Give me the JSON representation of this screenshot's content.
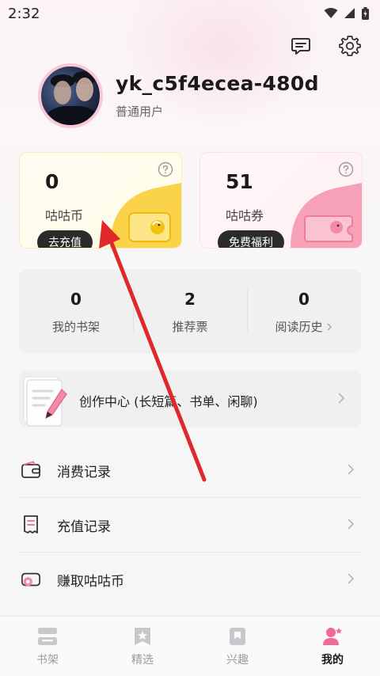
{
  "status_bar": {
    "time": "2:32"
  },
  "profile": {
    "username": "yk_c5f4ecea-480d",
    "level": "普通用户"
  },
  "wallet": {
    "coins": {
      "value": "0",
      "label": "咕咕币",
      "button": "去充值"
    },
    "vouchers": {
      "value": "51",
      "label": "咕咕券",
      "button": "免费福利"
    }
  },
  "stats": [
    {
      "value": "0",
      "label": "我的书架"
    },
    {
      "value": "2",
      "label": "推荐票"
    },
    {
      "value": "0",
      "label": "阅读历史"
    }
  ],
  "creation": {
    "label": "创作中心 (长短篇、书单、闲聊)"
  },
  "menu": [
    {
      "label": "消费记录",
      "icon": "wallet-icon"
    },
    {
      "label": "充值记录",
      "icon": "receipt-icon"
    },
    {
      "label": "赚取咕咕币",
      "icon": "earn-coins-icon"
    }
  ],
  "tabs": [
    {
      "label": "书架",
      "icon": "bookshelf-icon",
      "active": false
    },
    {
      "label": "精选",
      "icon": "featured-icon",
      "active": false
    },
    {
      "label": "兴趣",
      "icon": "interest-icon",
      "active": false
    },
    {
      "label": "我的",
      "icon": "profile-icon",
      "active": true
    }
  ],
  "colors": {
    "accent_pink": "#f06a94",
    "dark_button": "#2b2b2b",
    "annotation_arrow": "#e0282a"
  }
}
